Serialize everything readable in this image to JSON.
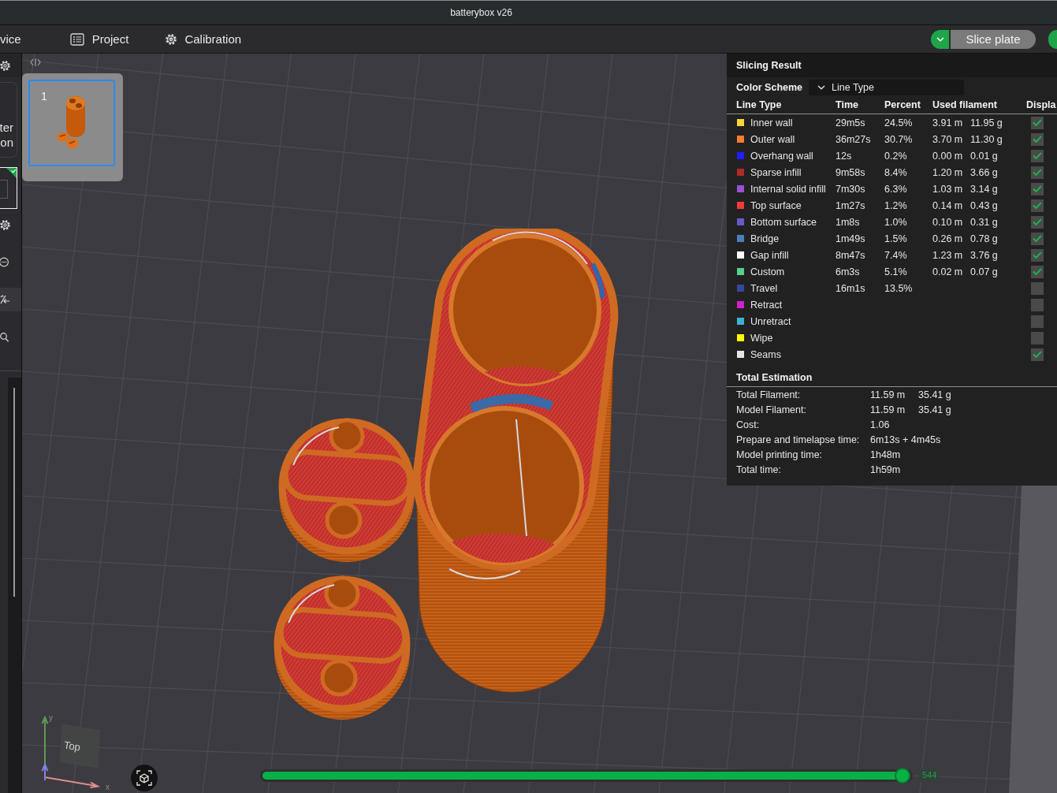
{
  "window": {
    "title": "batterybox v26"
  },
  "menu_bar": {
    "items": [
      {
        "label": "vice"
      },
      {
        "label": "Project"
      },
      {
        "label": "Calibration"
      }
    ],
    "slice_button": {
      "label": "Slice plate"
    }
  },
  "sidebar": {
    "card_lines": [
      "ter",
      "on"
    ],
    "tile": {
      "selected": true
    }
  },
  "plates": [
    {
      "number": "1",
      "selected": true
    }
  ],
  "slicing_result": {
    "title": "Slicing Result",
    "color_scheme": {
      "label": "Color Scheme",
      "value": "Line Type"
    },
    "columns": [
      "Line Type",
      "Time",
      "Percent",
      "Used filament",
      "Displa"
    ],
    "rows": [
      {
        "name": "Inner wall",
        "color": "#f7d63c",
        "time": "29m5s",
        "percent": "24.5%",
        "length": "3.91 m",
        "weight": "11.95 g",
        "checked": true
      },
      {
        "name": "Outer wall",
        "color": "#ff7d2e",
        "time": "36m27s",
        "percent": "30.7%",
        "length": "3.70 m",
        "weight": "11.30 g",
        "checked": true
      },
      {
        "name": "Overhang wall",
        "color": "#1e1eff",
        "time": "12s",
        "percent": "0.2%",
        "length": "0.00 m",
        "weight": "0.01 g",
        "checked": true
      },
      {
        "name": "Sparse infill",
        "color": "#b12a28",
        "time": "9m58s",
        "percent": "8.4%",
        "length": "1.20 m",
        "weight": "3.66 g",
        "checked": true
      },
      {
        "name": "Internal solid infill",
        "color": "#9b4fd1",
        "time": "7m30s",
        "percent": "6.3%",
        "length": "1.03 m",
        "weight": "3.14 g",
        "checked": true
      },
      {
        "name": "Top surface",
        "color": "#f03a3a",
        "time": "1m27s",
        "percent": "1.2%",
        "length": "0.14 m",
        "weight": "0.43 g",
        "checked": true
      },
      {
        "name": "Bottom surface",
        "color": "#6a57c8",
        "time": "1m8s",
        "percent": "1.0%",
        "length": "0.10 m",
        "weight": "0.31 g",
        "checked": true
      },
      {
        "name": "Bridge",
        "color": "#4c7fbf",
        "time": "1m49s",
        "percent": "1.5%",
        "length": "0.26 m",
        "weight": "0.78 g",
        "checked": true
      },
      {
        "name": "Gap infill",
        "color": "#ffffff",
        "time": "8m47s",
        "percent": "7.4%",
        "length": "1.23 m",
        "weight": "3.76 g",
        "checked": true
      },
      {
        "name": "Custom",
        "color": "#55d08b",
        "time": "6m3s",
        "percent": "5.1%",
        "length": "0.02 m",
        "weight": "0.07 g",
        "checked": true
      },
      {
        "name": "Travel",
        "color": "#38459c",
        "time": "16m1s",
        "percent": "13.5%",
        "checked": false
      },
      {
        "name": "Retract",
        "color": "#d21fd2",
        "checked": false
      },
      {
        "name": "Unretract",
        "color": "#3fb0d4",
        "checked": false
      },
      {
        "name": "Wipe",
        "color": "#ffff00",
        "checked": false
      },
      {
        "name": "Seams",
        "color": "#e6e6e6",
        "checked": true
      }
    ]
  },
  "total_estimation": {
    "title": "Total Estimation",
    "rows": [
      {
        "label": "Total Filament:",
        "values": [
          "11.59 m",
          "35.41 g"
        ]
      },
      {
        "label": "Model Filament:",
        "values": [
          "11.59 m",
          "35.41 g"
        ]
      },
      {
        "label": "Cost:",
        "values": [
          "1.06"
        ]
      },
      {
        "label": "Prepare and timelapse time:",
        "values": [
          "6m13s + 4m45s"
        ]
      },
      {
        "label": "Model printing time:",
        "values": [
          "1h48m"
        ]
      },
      {
        "label": "Total time:",
        "values": [
          "1h59m"
        ]
      }
    ]
  },
  "view_gizmo": {
    "face": "Top",
    "axis_labels": [
      "y",
      "x"
    ]
  },
  "layer_slider": {
    "level": 1,
    "reading": "544"
  }
}
